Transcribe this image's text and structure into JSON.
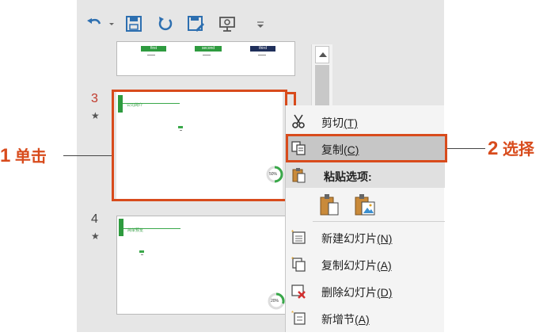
{
  "quick_access": {
    "icons": [
      "undo-icon",
      "save-icon",
      "redo-icon",
      "save-as-icon",
      "present-icon",
      "customize-icon"
    ]
  },
  "slides": {
    "slide2_tabs": [
      "first",
      "second",
      "third"
    ],
    "slide3": {
      "number": "3",
      "star": "★",
      "title": "公司简介",
      "percent": "50%"
    },
    "slide4": {
      "number": "4",
      "star": "★",
      "title": "简单预览",
      "percent": "20%"
    }
  },
  "context_menu": {
    "cut": {
      "label": "剪切",
      "key": "(T)"
    },
    "copy": {
      "label": "复制",
      "key": "(C)"
    },
    "paste_options": "粘贴选项:",
    "new_slide": {
      "label": "新建幻灯片",
      "key": "(N)"
    },
    "duplicate_slide": {
      "label": "复制幻灯片",
      "key": "(A)"
    },
    "delete_slide": {
      "label": "删除幻灯片",
      "key": "(D)"
    },
    "new_section": {
      "label": "新增节",
      "key": "(A)"
    }
  },
  "annotations": {
    "step1": {
      "num": "1",
      "text": "单击"
    },
    "step2": {
      "num": "2",
      "text": "选择"
    }
  },
  "colors": {
    "accent": "#d84b1c",
    "slide_green": "#2e9b3f",
    "menu_highlight": "#c6c6c6"
  }
}
